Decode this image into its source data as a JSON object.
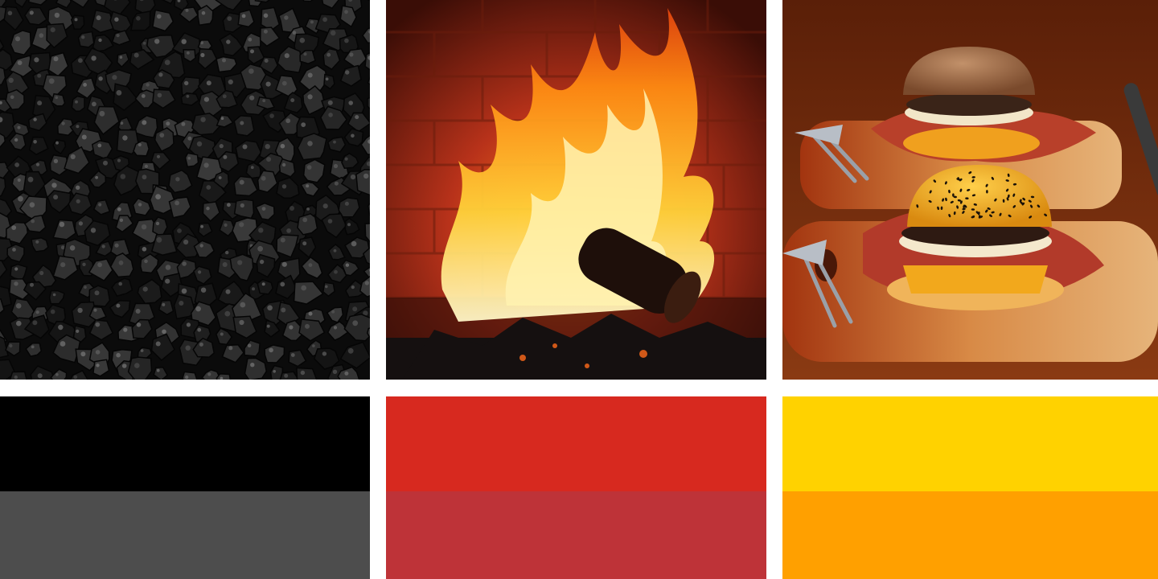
{
  "palette": [
    {
      "photo": "coal-pieces",
      "primary_color": "#000000",
      "secondary_color": "#4d4d4d"
    },
    {
      "photo": "fireplace-flames",
      "primary_color": "#d7291f",
      "secondary_color": "#be3338"
    },
    {
      "photo": "bacon-cheeseburgers-on-boards",
      "primary_color": "#ffd200",
      "secondary_color": "#ffa000"
    }
  ]
}
